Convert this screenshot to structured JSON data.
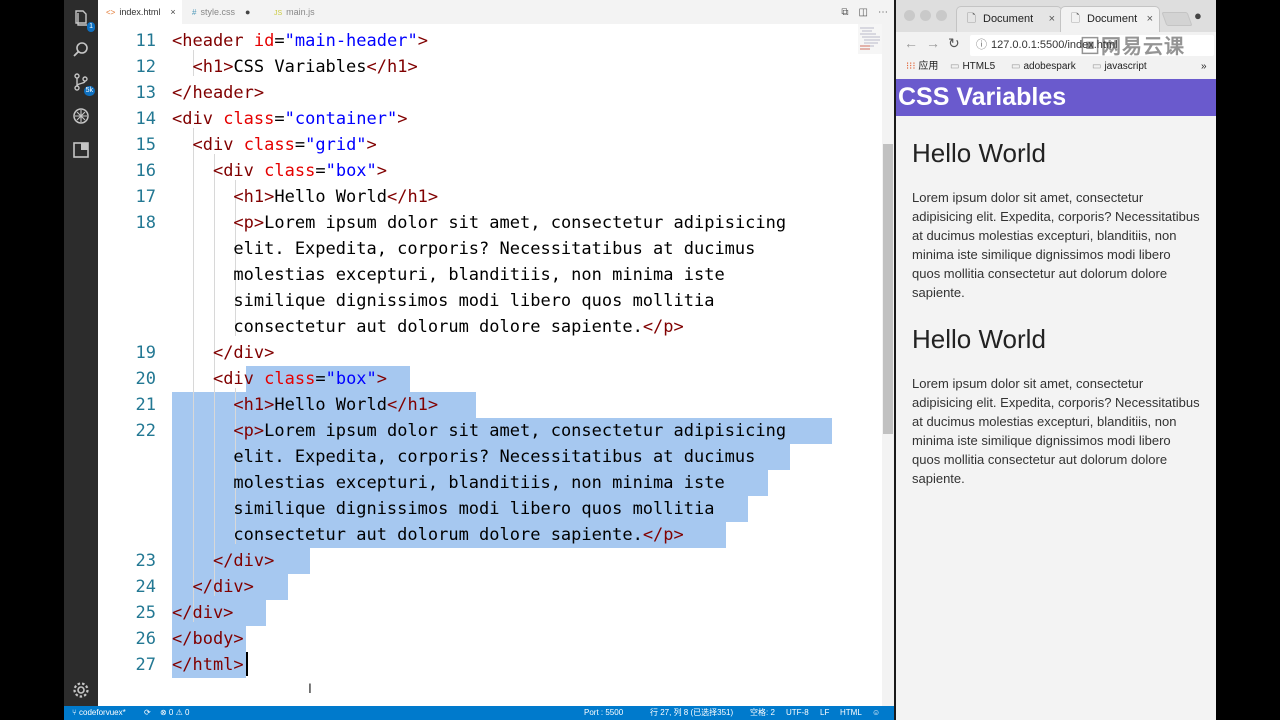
{
  "editor": {
    "tabs": [
      {
        "icon": "<>",
        "label": "index.html",
        "action": "×"
      },
      {
        "icon": "#",
        "label": "style.css",
        "action": "●"
      },
      {
        "icon": "JS",
        "label": "main.js",
        "action": ""
      }
    ],
    "activity_badges": {
      "explorer": "1",
      "source_control": "5k"
    },
    "code_lines": [
      {
        "n": "11",
        "html": "<span class=\"tg\">&lt;header</span> <span class=\"at\">id</span>=<span class=\"st\">\"main-header\"</span><span class=\"tg\">&gt;</span>"
      },
      {
        "n": "12",
        "html": "  <span class=\"tg\">&lt;h1&gt;</span>CSS Variables<span class=\"tg\">&lt;/h1&gt;</span>"
      },
      {
        "n": "13",
        "html": "<span class=\"tg\">&lt;/header&gt;</span>"
      },
      {
        "n": "14",
        "html": "<span class=\"tg\">&lt;div</span> <span class=\"at\">class</span>=<span class=\"st\">\"container\"</span><span class=\"tg\">&gt;</span>"
      },
      {
        "n": "15",
        "html": "  <span class=\"tg\">&lt;div</span> <span class=\"at\">class</span>=<span class=\"st\">\"grid\"</span><span class=\"tg\">&gt;</span>"
      },
      {
        "n": "16",
        "html": "    <span class=\"tg\">&lt;div</span> <span class=\"at\">class</span>=<span class=\"st\">\"box\"</span><span class=\"tg\">&gt;</span>"
      },
      {
        "n": "17",
        "html": "      <span class=\"tg\">&lt;h1&gt;</span>Hello World<span class=\"tg\">&lt;/h1&gt;</span>"
      },
      {
        "n": "18",
        "html": "      <span class=\"tg\">&lt;p&gt;</span>Lorem ipsum dolor sit amet, consectetur adipisicing"
      },
      {
        "n": "",
        "html": "      elit. Expedita, corporis? Necessitatibus at ducimus"
      },
      {
        "n": "",
        "html": "      molestias excepturi, blanditiis, non minima iste"
      },
      {
        "n": "",
        "html": "      similique dignissimos modi libero quos mollitia"
      },
      {
        "n": "",
        "html": "      consectetur aut dolorum dolore sapiente.<span class=\"tg\">&lt;/p&gt;</span>"
      },
      {
        "n": "19",
        "html": "    <span class=\"tg\">&lt;/div&gt;</span>"
      },
      {
        "n": "20",
        "html": "    <span class=\"tg\">&lt;div</span> <span class=\"at\">class</span>=<span class=\"st\">\"box\"</span><span class=\"tg\">&gt;</span>"
      },
      {
        "n": "21",
        "html": "      <span class=\"tg\">&lt;h1&gt;</span>Hello World<span class=\"tg\">&lt;/h1&gt;</span>"
      },
      {
        "n": "22",
        "html": "      <span class=\"tg\">&lt;p&gt;</span>Lorem ipsum dolor sit amet, consectetur adipisicing"
      },
      {
        "n": "",
        "html": "      elit. Expedita, corporis? Necessitatibus at ducimus"
      },
      {
        "n": "",
        "html": "      molestias excepturi, blanditiis, non minima iste"
      },
      {
        "n": "",
        "html": "      similique dignissimos modi libero quos mollitia"
      },
      {
        "n": "",
        "html": "      consectetur aut dolorum dolore sapiente.<span class=\"tg\">&lt;/p&gt;</span>"
      },
      {
        "n": "23",
        "html": "    <span class=\"tg\">&lt;/div&gt;</span>"
      },
      {
        "n": "24",
        "html": "  <span class=\"tg\">&lt;/div&gt;</span>"
      },
      {
        "n": "25",
        "html": "<span class=\"tg\">&lt;/div&gt;</span>"
      },
      {
        "n": "26",
        "html": "<span class=\"tg\">&lt;/body&gt;</span>"
      },
      {
        "n": "27",
        "html": "<span class=\"tg\">&lt;/html&gt;</span>"
      }
    ],
    "status": {
      "branch": "codeforvuex*",
      "problems": "⊗ 0 ⚠ 0",
      "port": "Port : 5500",
      "cursor": "行 27, 列 8 (已选择351)",
      "spaces": "空格: 2",
      "encoding": "UTF-8",
      "eol": "LF",
      "language": "HTML"
    },
    "colors": {
      "selection": "#a6c8f0",
      "status_bar": "#007acc",
      "tag": "#800000",
      "attr": "#e50000",
      "string": "#0000ff",
      "line_number": "#237893"
    }
  },
  "browser": {
    "tabs": [
      {
        "label": "Document"
      },
      {
        "label": "Document"
      }
    ],
    "url": "127.0.0.1:5500/index.html",
    "watermark": "网易云课",
    "bookmarks": {
      "apps": "应用",
      "items": [
        "HTML5",
        "adobespark",
        "javascript"
      ],
      "more": "»"
    },
    "page": {
      "header_title": "CSS Variables",
      "boxes": [
        {
          "title": "Hello World",
          "text": "Lorem ipsum dolor sit amet, consectetur adipisicing elit. Expedita, corporis? Necessitatibus at ducimus molestias excepturi, blanditiis, non minima iste similique dignissimos modi libero quos mollitia consectetur aut dolorum dolore sapiente."
        },
        {
          "title": "Hello World",
          "text": "Lorem ipsum dolor sit amet, consectetur adipisicing elit. Expedita, corporis? Necessitatibus at ducimus molestias excepturi, blanditiis, non minima iste similique dignissimos modi libero quos mollitia consectetur aut dolorum dolore sapiente."
        }
      ]
    },
    "colors": {
      "header_bg": "#6a5acd",
      "page_bg": "#f3f3f3"
    }
  }
}
